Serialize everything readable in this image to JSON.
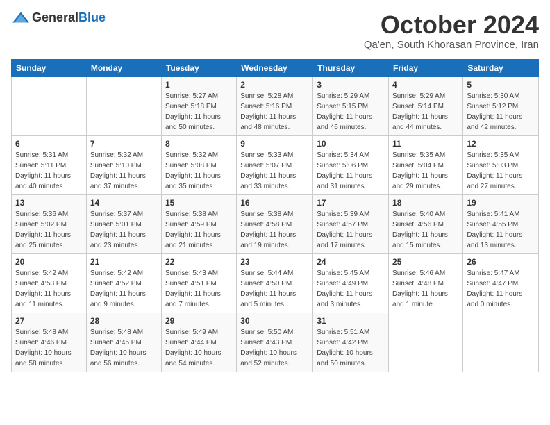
{
  "header": {
    "logo_general": "General",
    "logo_blue": "Blue",
    "month_title": "October 2024",
    "location": "Qa'en, South Khorasan Province, Iran"
  },
  "weekdays": [
    "Sunday",
    "Monday",
    "Tuesday",
    "Wednesday",
    "Thursday",
    "Friday",
    "Saturday"
  ],
  "weeks": [
    [
      {
        "day": "",
        "details": ""
      },
      {
        "day": "",
        "details": ""
      },
      {
        "day": "1",
        "details": "Sunrise: 5:27 AM\nSunset: 5:18 PM\nDaylight: 11 hours and 50 minutes."
      },
      {
        "day": "2",
        "details": "Sunrise: 5:28 AM\nSunset: 5:16 PM\nDaylight: 11 hours and 48 minutes."
      },
      {
        "day": "3",
        "details": "Sunrise: 5:29 AM\nSunset: 5:15 PM\nDaylight: 11 hours and 46 minutes."
      },
      {
        "day": "4",
        "details": "Sunrise: 5:29 AM\nSunset: 5:14 PM\nDaylight: 11 hours and 44 minutes."
      },
      {
        "day": "5",
        "details": "Sunrise: 5:30 AM\nSunset: 5:12 PM\nDaylight: 11 hours and 42 minutes."
      }
    ],
    [
      {
        "day": "6",
        "details": "Sunrise: 5:31 AM\nSunset: 5:11 PM\nDaylight: 11 hours and 40 minutes."
      },
      {
        "day": "7",
        "details": "Sunrise: 5:32 AM\nSunset: 5:10 PM\nDaylight: 11 hours and 37 minutes."
      },
      {
        "day": "8",
        "details": "Sunrise: 5:32 AM\nSunset: 5:08 PM\nDaylight: 11 hours and 35 minutes."
      },
      {
        "day": "9",
        "details": "Sunrise: 5:33 AM\nSunset: 5:07 PM\nDaylight: 11 hours and 33 minutes."
      },
      {
        "day": "10",
        "details": "Sunrise: 5:34 AM\nSunset: 5:06 PM\nDaylight: 11 hours and 31 minutes."
      },
      {
        "day": "11",
        "details": "Sunrise: 5:35 AM\nSunset: 5:04 PM\nDaylight: 11 hours and 29 minutes."
      },
      {
        "day": "12",
        "details": "Sunrise: 5:35 AM\nSunset: 5:03 PM\nDaylight: 11 hours and 27 minutes."
      }
    ],
    [
      {
        "day": "13",
        "details": "Sunrise: 5:36 AM\nSunset: 5:02 PM\nDaylight: 11 hours and 25 minutes."
      },
      {
        "day": "14",
        "details": "Sunrise: 5:37 AM\nSunset: 5:01 PM\nDaylight: 11 hours and 23 minutes."
      },
      {
        "day": "15",
        "details": "Sunrise: 5:38 AM\nSunset: 4:59 PM\nDaylight: 11 hours and 21 minutes."
      },
      {
        "day": "16",
        "details": "Sunrise: 5:38 AM\nSunset: 4:58 PM\nDaylight: 11 hours and 19 minutes."
      },
      {
        "day": "17",
        "details": "Sunrise: 5:39 AM\nSunset: 4:57 PM\nDaylight: 11 hours and 17 minutes."
      },
      {
        "day": "18",
        "details": "Sunrise: 5:40 AM\nSunset: 4:56 PM\nDaylight: 11 hours and 15 minutes."
      },
      {
        "day": "19",
        "details": "Sunrise: 5:41 AM\nSunset: 4:55 PM\nDaylight: 11 hours and 13 minutes."
      }
    ],
    [
      {
        "day": "20",
        "details": "Sunrise: 5:42 AM\nSunset: 4:53 PM\nDaylight: 11 hours and 11 minutes."
      },
      {
        "day": "21",
        "details": "Sunrise: 5:42 AM\nSunset: 4:52 PM\nDaylight: 11 hours and 9 minutes."
      },
      {
        "day": "22",
        "details": "Sunrise: 5:43 AM\nSunset: 4:51 PM\nDaylight: 11 hours and 7 minutes."
      },
      {
        "day": "23",
        "details": "Sunrise: 5:44 AM\nSunset: 4:50 PM\nDaylight: 11 hours and 5 minutes."
      },
      {
        "day": "24",
        "details": "Sunrise: 5:45 AM\nSunset: 4:49 PM\nDaylight: 11 hours and 3 minutes."
      },
      {
        "day": "25",
        "details": "Sunrise: 5:46 AM\nSunset: 4:48 PM\nDaylight: 11 hours and 1 minute."
      },
      {
        "day": "26",
        "details": "Sunrise: 5:47 AM\nSunset: 4:47 PM\nDaylight: 11 hours and 0 minutes."
      }
    ],
    [
      {
        "day": "27",
        "details": "Sunrise: 5:48 AM\nSunset: 4:46 PM\nDaylight: 10 hours and 58 minutes."
      },
      {
        "day": "28",
        "details": "Sunrise: 5:48 AM\nSunset: 4:45 PM\nDaylight: 10 hours and 56 minutes."
      },
      {
        "day": "29",
        "details": "Sunrise: 5:49 AM\nSunset: 4:44 PM\nDaylight: 10 hours and 54 minutes."
      },
      {
        "day": "30",
        "details": "Sunrise: 5:50 AM\nSunset: 4:43 PM\nDaylight: 10 hours and 52 minutes."
      },
      {
        "day": "31",
        "details": "Sunrise: 5:51 AM\nSunset: 4:42 PM\nDaylight: 10 hours and 50 minutes."
      },
      {
        "day": "",
        "details": ""
      },
      {
        "day": "",
        "details": ""
      }
    ]
  ]
}
